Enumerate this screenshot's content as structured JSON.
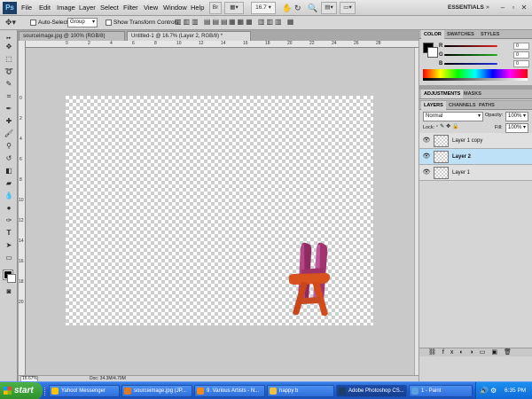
{
  "menubar": {
    "logo": "Ps",
    "items": [
      "File",
      "Edit",
      "Image",
      "Layer",
      "Select",
      "Filter",
      "View",
      "Window",
      "Help"
    ],
    "zoom_value": "16.7",
    "workspace": "ESSENTIALS"
  },
  "options": {
    "auto_select_label": "Auto-Select:",
    "auto_select_value": "Group",
    "transform_label": "Show Transform Controls"
  },
  "doc_tabs": [
    {
      "label": "sourceimage.jpg @ 100% (RGB/8)"
    },
    {
      "label": "Untitled-1 @ 16.7% (Layer 2, RGB/8) *"
    }
  ],
  "ruler": {
    "h_numbers": [
      "0",
      "2",
      "4",
      "6",
      "8",
      "10",
      "12",
      "14",
      "16",
      "18",
      "20",
      "22",
      "24",
      "26",
      "28"
    ],
    "v_numbers": [
      "0",
      "2",
      "4",
      "6",
      "8",
      "10",
      "12",
      "14",
      "16",
      "18",
      "20"
    ]
  },
  "status": {
    "zoom": "16.67%",
    "doc": "Doc: 34.3M/4.79M"
  },
  "color_panel": {
    "tabs": [
      "COLOR",
      "SWATCHES",
      "STYLES"
    ],
    "channels": [
      {
        "letter": "R",
        "value": "0",
        "color": "#e02020"
      },
      {
        "letter": "G",
        "value": "0",
        "color": "#20b020"
      },
      {
        "letter": "B",
        "value": "0",
        "color": "#2030e0"
      }
    ]
  },
  "adjust_panel": {
    "tabs": [
      "ADJUSTMENTS",
      "MASKS"
    ]
  },
  "layers_panel": {
    "tabs": [
      "LAYERS",
      "CHANNELS",
      "PATHS"
    ],
    "blend_mode": "Normal",
    "opacity_label": "Opacity:",
    "opacity_value": "100%",
    "lock_label": "Lock:",
    "fill_label": "Fill:",
    "fill_value": "100%",
    "layers": [
      {
        "name": "Layer 1 copy",
        "selected": false
      },
      {
        "name": "Layer 2",
        "selected": true
      },
      {
        "name": "Layer 1",
        "selected": false
      }
    ]
  },
  "taskbar": {
    "start": "start",
    "tasks": [
      {
        "label": "Yahoo! Messenger",
        "icon": "#f5c400",
        "active": false
      },
      {
        "label": "sourceimage.jpg (JP...",
        "icon": "#e07a20",
        "active": false
      },
      {
        "label": "9. Various Artists - N...",
        "icon": "#f08a20",
        "active": false
      },
      {
        "label": "happy b",
        "icon": "#f0c040",
        "active": false
      },
      {
        "label": "Adobe Photoshop CS...",
        "icon": "#1b3f66",
        "active": true
      },
      {
        "label": "1 - Paint",
        "icon": "#5aa0e0",
        "active": false
      }
    ],
    "clock": "6:35 PM"
  },
  "colors": {
    "taskbar_blue": "#2a66d4",
    "start_green": "#35a030",
    "selected_layer": "#bfe1f8",
    "letter_h_magenta": "#a83070",
    "letter_a_orange": "#d8501c"
  }
}
